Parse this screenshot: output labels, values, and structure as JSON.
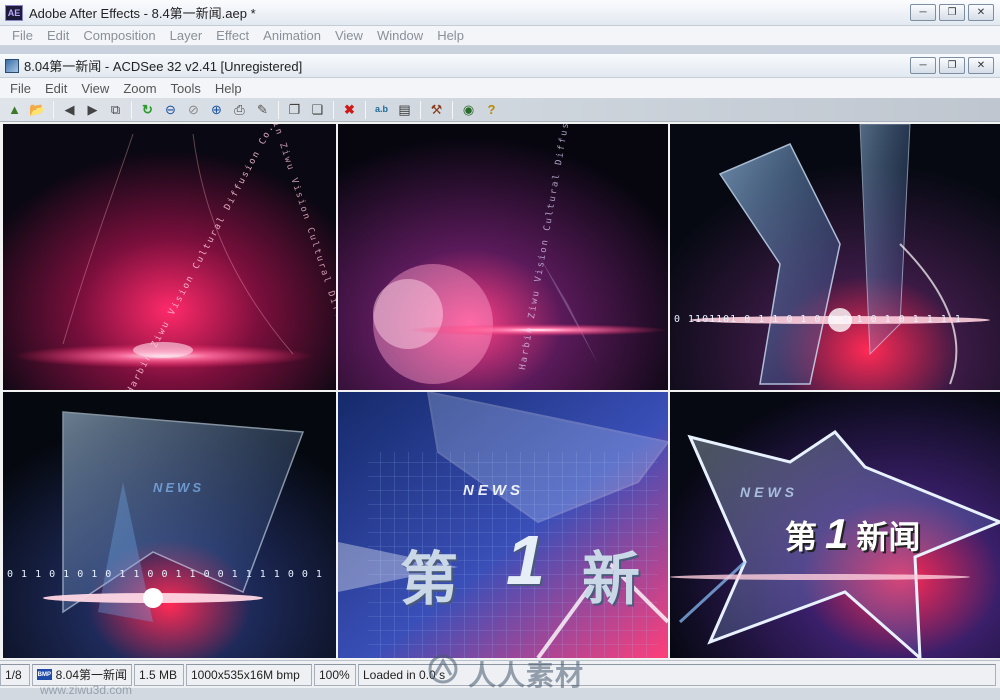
{
  "ae_window": {
    "title": "Adobe After Effects - 8.4第一新闻.aep *",
    "logo_text": "AE",
    "menu": [
      "File",
      "Edit",
      "Composition",
      "Layer",
      "Effect",
      "Animation",
      "View",
      "Window",
      "Help"
    ]
  },
  "acdsee_window": {
    "title": "8.04第一新闻 - ACDSee 32 v2.41 [Unregistered]",
    "menu": [
      "File",
      "Edit",
      "View",
      "Zoom",
      "Tools",
      "Help"
    ]
  },
  "window_controls": {
    "minimize_icon": "minimize-icon",
    "restore_icon": "restore-icon",
    "close_icon": "close-icon"
  },
  "toolbar_icons": [
    "browse-icon",
    "open-icon",
    "previous-icon",
    "next-icon",
    "copy-icon",
    "rotate-icon",
    "zoom-out-icon",
    "zoom-icon",
    "zoom-in-icon",
    "print-icon",
    "scan-icon",
    "copy-to-icon",
    "move-to-icon",
    "delete-icon",
    "rename-icon",
    "properties-icon",
    "tools-icon",
    "view-icon",
    "help-icon"
  ],
  "frames": {
    "frame1_text": "Harbin Ziwu Vision Cultural Diffusion Co.Ltd",
    "binary_text": "0 1101101 0 1 1 0 1 0 1 0 1 0 1 0 1 1 1 1",
    "binary_text_2": "0 1 1 0 1 0 1 0 1 1 0 0 1 1 0 0 1 1 1 1 0 0 1",
    "news_text": "NEWS",
    "headline_char1": "第",
    "headline_char2": "1",
    "headline_char3": "新",
    "headline_full_prefix": "第",
    "headline_full_num": "1",
    "headline_full_suffix": "新闻"
  },
  "status": {
    "index": "1/8",
    "badge": "BMP",
    "filename": "8.04第一新闻",
    "filesize": "1.5 MB",
    "dimensions": "1000x535x16M bmp",
    "zoom": "100%",
    "load_text": "Loaded in 0.0 s"
  },
  "watermarks": {
    "left": "www.ziwu3d.com",
    "center": "人人素材"
  },
  "colors": {
    "accent_red": "#ff2a55",
    "accent_blue": "#4aa8ff",
    "bg_dark": "#05060d"
  }
}
